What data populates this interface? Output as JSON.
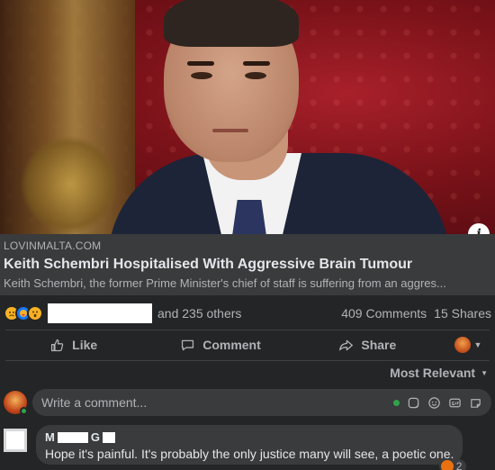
{
  "colors": {
    "background": "#242526",
    "surface": "#3a3b3c",
    "text": "#e4e6eb",
    "muted": "#b0b3b8",
    "online": "#31a24c"
  },
  "link": {
    "source": "LOVINMALTA.COM",
    "headline": "Keith Schembri Hospitalised With Aggressive Brain Tumour",
    "description": "Keith Schembri, the former Prime Minister's chief of staff is suffering from an aggres..."
  },
  "reactions": {
    "emoji_icons": [
      "sad-reaction-icon",
      "care-reaction-icon",
      "wow-reaction-icon"
    ],
    "others_text": "and 235 others",
    "comments_count": "409 Comments",
    "shares_count": "15 Shares"
  },
  "actions": {
    "like": "Like",
    "comment": "Comment",
    "share": "Share"
  },
  "sort": {
    "label": "Most Relevant"
  },
  "composer": {
    "placeholder": "Write a comment..."
  },
  "comments": [
    {
      "author_prefix": "M",
      "author_suffix": "G",
      "text": "Hope it's painful. It's probably the only justice many will see, a poetic one.",
      "reaction_count": "2",
      "reaction_icon": "angry-reaction-icon"
    }
  ]
}
